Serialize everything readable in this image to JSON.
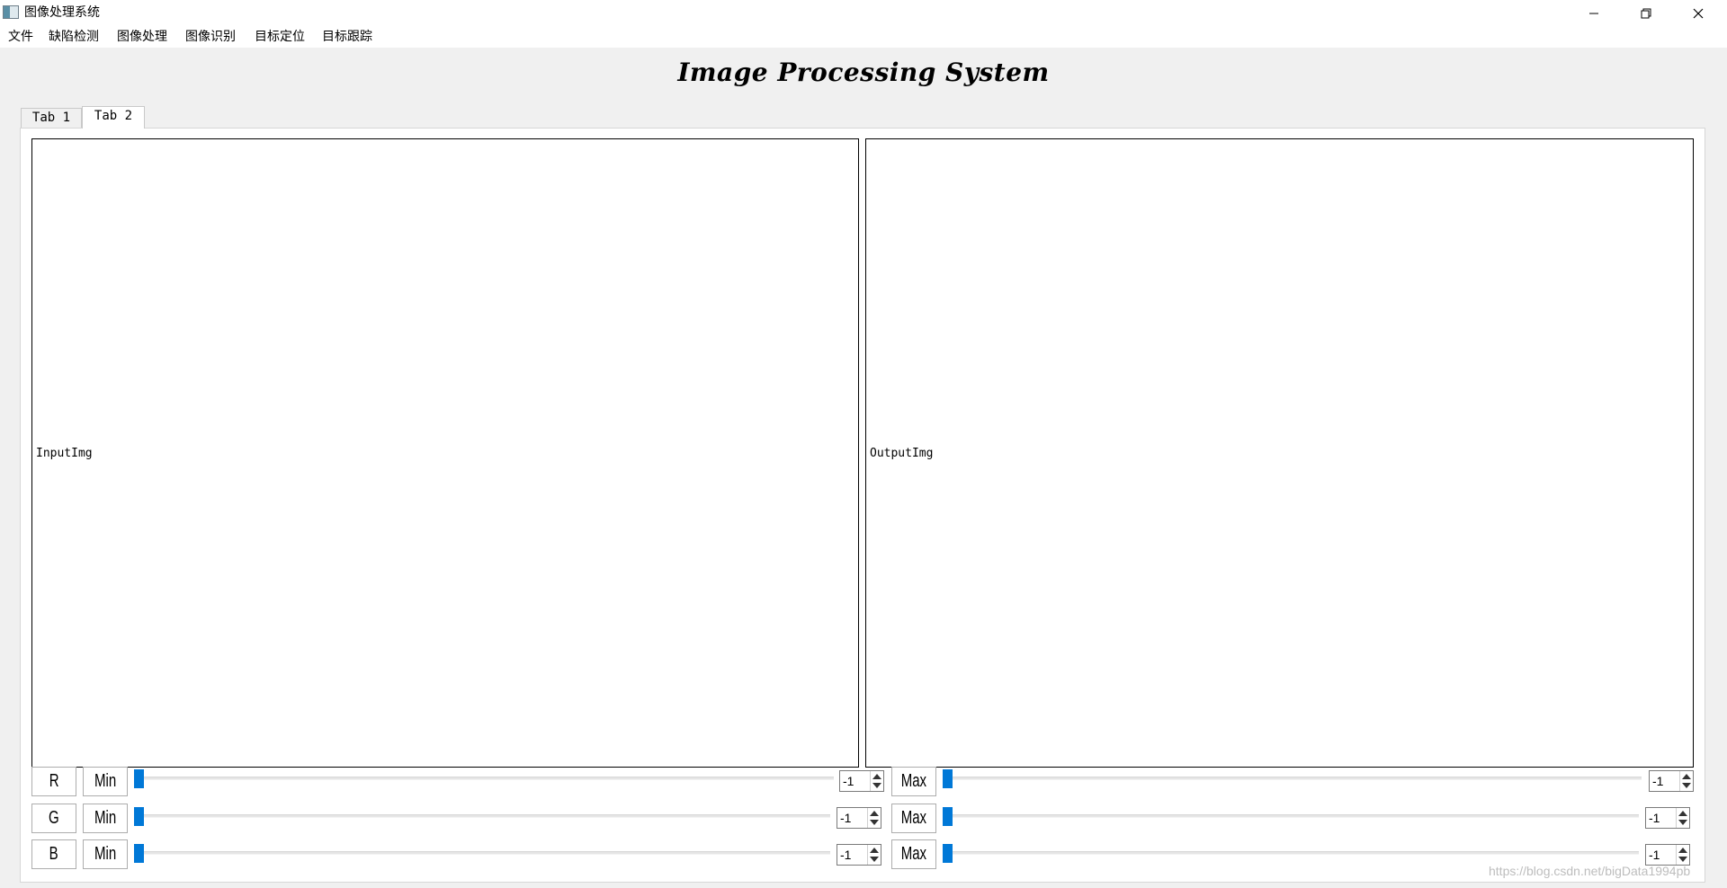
{
  "window": {
    "title": "图像处理系统",
    "icon": "app-window-icon",
    "controls": [
      "minimize-icon",
      "restore-icon",
      "close-icon"
    ]
  },
  "menu": [
    {
      "label": "文件"
    },
    {
      "label": "缺陷检测"
    },
    {
      "label": "图像处理"
    },
    {
      "label": "图像识别"
    },
    {
      "label": "目标定位"
    },
    {
      "label": "目标跟踪"
    }
  ],
  "app": {
    "heading": "Image Processing System"
  },
  "tabs": [
    {
      "label": "Tab 1",
      "selected": false
    },
    {
      "label": "Tab 2",
      "selected": true
    }
  ],
  "panels": {
    "input_label": "InputImg",
    "output_label": "OutputImg"
  },
  "controls": [
    {
      "channel": "R",
      "min_label": "Min",
      "min_value": "-1",
      "max_label": "Max",
      "max_value": "-1",
      "min_slider_level": 0,
      "max_slider_level": 0
    },
    {
      "channel": "G",
      "min_label": "Min",
      "min_value": "-1",
      "max_label": "Max",
      "max_value": "-1",
      "min_slider_level": 0,
      "max_slider_level": 0
    },
    {
      "channel": "B",
      "min_label": "Min",
      "min_value": "-1",
      "max_label": "Max",
      "max_value": "-1",
      "min_slider_level": 0,
      "max_slider_level": 0
    }
  ],
  "watermark": "https://blog.csdn.net/bigData1994pb",
  "colors": {
    "accent": "#0078d7",
    "background": "#f0f0f0",
    "surface": "#ffffff"
  }
}
